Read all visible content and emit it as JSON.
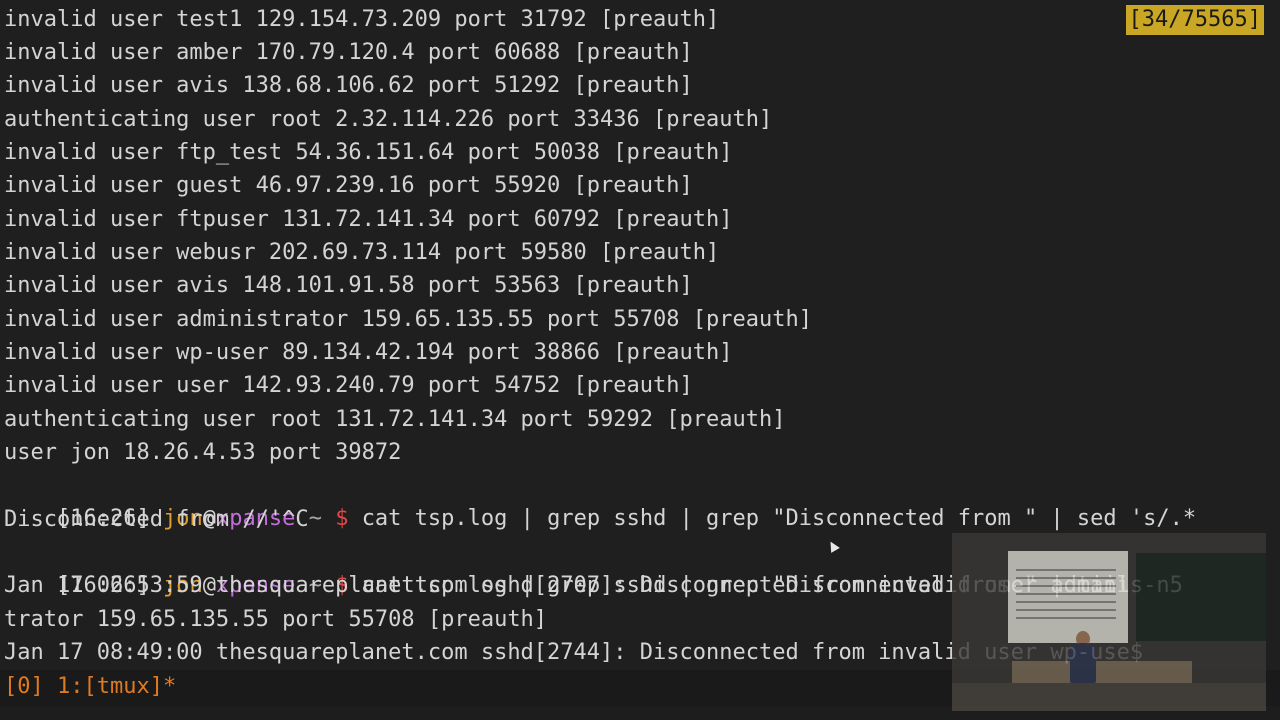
{
  "terminal": {
    "log_lines": [
      "invalid user test1 129.154.73.209 port 31792 [preauth]",
      "invalid user amber 170.79.120.4 port 60688 [preauth]",
      "invalid user avis 138.68.106.62 port 51292 [preauth]",
      "authenticating user root 2.32.114.226 port 33436 [preauth]",
      "invalid user ftp_test 54.36.151.64 port 50038 [preauth]",
      "invalid user guest 46.97.239.16 port 55920 [preauth]",
      "invalid user ftpuser 131.72.141.34 port 60792 [preauth]",
      "invalid user webusr 202.69.73.114 port 59580 [preauth]",
      "invalid user avis 148.101.91.58 port 53563 [preauth]",
      "invalid user administrator 159.65.135.55 port 55708 [preauth]",
      "invalid user wp-user 89.134.42.194 port 38866 [preauth]",
      "invalid user user 142.93.240.79 port 54752 [preauth]",
      "authenticating user root 131.72.141.34 port 59292 [preauth]",
      "user jon 18.26.4.53 port 39872"
    ],
    "prompt1": {
      "time": "[16:26]",
      "user": "jon",
      "at": "@",
      "host": "xpanse",
      "tilde": "~",
      "dollar": "$",
      "command": "cat tsp.log | grep sshd | grep \"Disconnected from \" | sed 's/.*"
    },
    "prompt1_wrap": "Disconnected from //'^C",
    "prompt2": {
      "time": "[16:26]",
      "user": "jon",
      "at": "@",
      "host": "xpanse",
      "tilde": "~",
      "dollar": "$",
      "command": "cat tsp.log | grep sshd | grep \"Disconnected from \" | tail -n5"
    },
    "output_lines": [
      "Jan 17 06:53:59 thesquareplanet.com sshd[2707]: Disconnected from invalid user adminis",
      "trator 159.65.135.55 port 55708 [preauth]",
      "Jan 17 08:49:00 thesquareplanet.com sshd[2744]: Disconnected from invalid user wp-use$"
    ],
    "pager_position": "[34/75565]"
  },
  "statusbar": {
    "text": "[0] 1:[tmux]*"
  },
  "colors": {
    "background": "#1f1f1f",
    "user": "#e0a030",
    "host": "#c16fd8",
    "dollar": "#e04848",
    "status": "#e07a20",
    "badge": "#c9a623"
  }
}
